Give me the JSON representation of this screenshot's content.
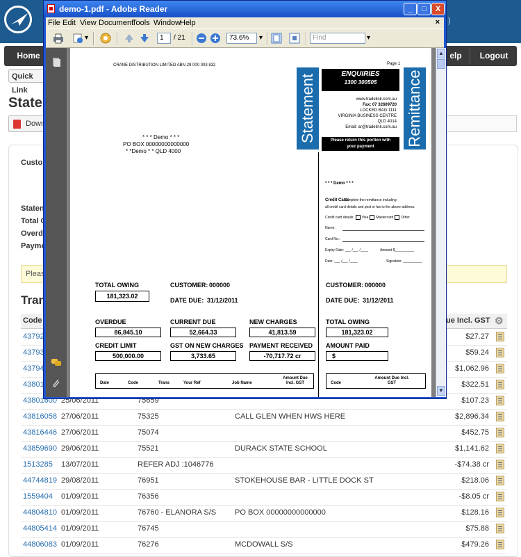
{
  "app": {
    "top_right_text": ")",
    "nav": {
      "home": "Home",
      "help": "elp",
      "logout": "Logout"
    },
    "quick_links": "Quick Link",
    "page_title": "Stater",
    "download_label": "Down",
    "summary_labels": [
      "Custo",
      "Staten",
      "Total C",
      "Overd",
      "Payme"
    ],
    "notice_text": "Pleas",
    "section_title": "Tran",
    "table": {
      "headers": {
        "code": "Code",
        "amount": "ue Incl. GST"
      },
      "rows": [
        {
          "code": "43792",
          "date": "",
          "ref": "",
          "job": "",
          "amount": "$27.27"
        },
        {
          "code": "43793",
          "date": "",
          "ref": "",
          "job": "",
          "amount": "$59.24"
        },
        {
          "code": "43794",
          "date": "",
          "ref": "",
          "job": "",
          "amount": "$1,062.96"
        },
        {
          "code": "43801",
          "date": "",
          "ref": "",
          "job": "",
          "amount": "$322.51"
        },
        {
          "code": "43801600",
          "date": "25/06/2011",
          "ref": "75659",
          "job": "",
          "amount": "$107.23"
        },
        {
          "code": "43816058",
          "date": "27/06/2011",
          "ref": "75325",
          "job": "CALL GLEN WHEN HWS HERE",
          "amount": "$2,896.34"
        },
        {
          "code": "43816446",
          "date": "27/06/2011",
          "ref": "75074",
          "job": "",
          "amount": "$452.75"
        },
        {
          "code": "43859690",
          "date": "29/06/2011",
          "ref": "75521",
          "job": "DURACK STATE SCHOOL",
          "amount": "$1,141.62"
        },
        {
          "code": "1513285",
          "date": "13/07/2011",
          "ref": "REFER ADJ :1046776",
          "job": "",
          "amount": "-$74.38 cr"
        },
        {
          "code": "44744819",
          "date": "29/08/2011",
          "ref": "76951",
          "job": "STOKEHOUSE BAR - LITTLE DOCK ST",
          "amount": "$218.06"
        },
        {
          "code": "1559404",
          "date": "01/09/2011",
          "ref": "76356",
          "job": "",
          "amount": "-$8.05 cr"
        },
        {
          "code": "44804810",
          "date": "01/09/2011",
          "ref": "76760 - ELANORA S/S",
          "job": "PO BOX 00000000000000",
          "amount": "$128.16"
        },
        {
          "code": "44805414",
          "date": "01/09/2011",
          "ref": "76745",
          "job": "",
          "amount": "$75.88"
        },
        {
          "code": "44806083",
          "date": "01/09/2011",
          "ref": "76276",
          "job": "MCDOWALL S/S",
          "amount": "$479.26"
        }
      ]
    }
  },
  "reader": {
    "title": "demo-1.pdf - Adobe Reader",
    "menu": [
      "File",
      "Edit",
      "View",
      "Document",
      "Tools",
      "Window",
      "Help"
    ],
    "menu_close": "×",
    "page_current": "1",
    "page_total": "/ 21",
    "zoom": "73.6%",
    "find_placeholder": "Find",
    "buttons": {
      "minimize": "_",
      "maximize": "□",
      "close": "X"
    }
  },
  "pdf": {
    "header_company": "CRANE DISTRIBUTION LIMITED ABN 29 000 003 832",
    "page_label": "Page 1",
    "statement_band": "Statement",
    "remittance_band": "Remittance",
    "enquiries_title": "ENQUIRIES",
    "enquiries_phone": "1300 300505",
    "contact_lines": [
      "www.tradelink.com.au",
      "Fax: 07 32609720",
      "LOCKED BAG 1111",
      "VIRGINIA BUSINESS CENTRE",
      "QLD 4014",
      "Email: ar@tradelink.com.au"
    ],
    "return_notice": "Please return this portion with your payment",
    "address_lines": [
      "* * * Demo * * *",
      "PO BOX 00000000000000",
      "* *Demo * * QLD 4000"
    ],
    "remit_name": "* * * Demo * * *",
    "credit_card_heading": "Credit Card:",
    "credit_card_text": "Complete the remittance including",
    "credit_card_text2": "all credit card details and post or fax to the above address.",
    "cc_details_label": "Credit card details:",
    "cc_visa": "Visa",
    "cc_mastercard": "Mastercard",
    "cc_other": "Other",
    "form_name": "Name:",
    "form_card": "Card No.:",
    "form_expiry": "Expiry Date: ___ /___ /____",
    "form_amount": "Amount $__________",
    "form_date": "Date: ___ /___ /____",
    "form_signature": "Signature: __________",
    "total_owing_label": "TOTAL OWING",
    "total_owing_value": "181,323.02",
    "customer_label": "CUSTOMER:",
    "customer_value": "000000",
    "date_due_label": "DATE DUE:",
    "date_due_value": "31/12/2011",
    "overdue_label": "OVERDUE",
    "overdue_value": "86,845.10",
    "current_due_label": "CURRENT DUE",
    "current_due_value": "52,664.33",
    "new_charges_label": "NEW CHARGES",
    "new_charges_value": "41,813.59",
    "credit_limit_label": "CREDIT LIMIT",
    "credit_limit_value": "500,000.00",
    "gst_label": "GST ON NEW CHARGES",
    "gst_value": "3,733.65",
    "payment_label": "PAYMENT RECEIVED",
    "payment_value": "-70,717.72 cr",
    "amount_paid_label": "AMOUNT PAID",
    "amount_paid_value": "$",
    "table_headers": [
      "Date",
      "Code",
      "Trans",
      "Your Ref",
      "Job Name",
      "Amount Due Incl. GST"
    ],
    "remit_table_headers": [
      "Code",
      "Amount Due Incl. GST"
    ]
  }
}
